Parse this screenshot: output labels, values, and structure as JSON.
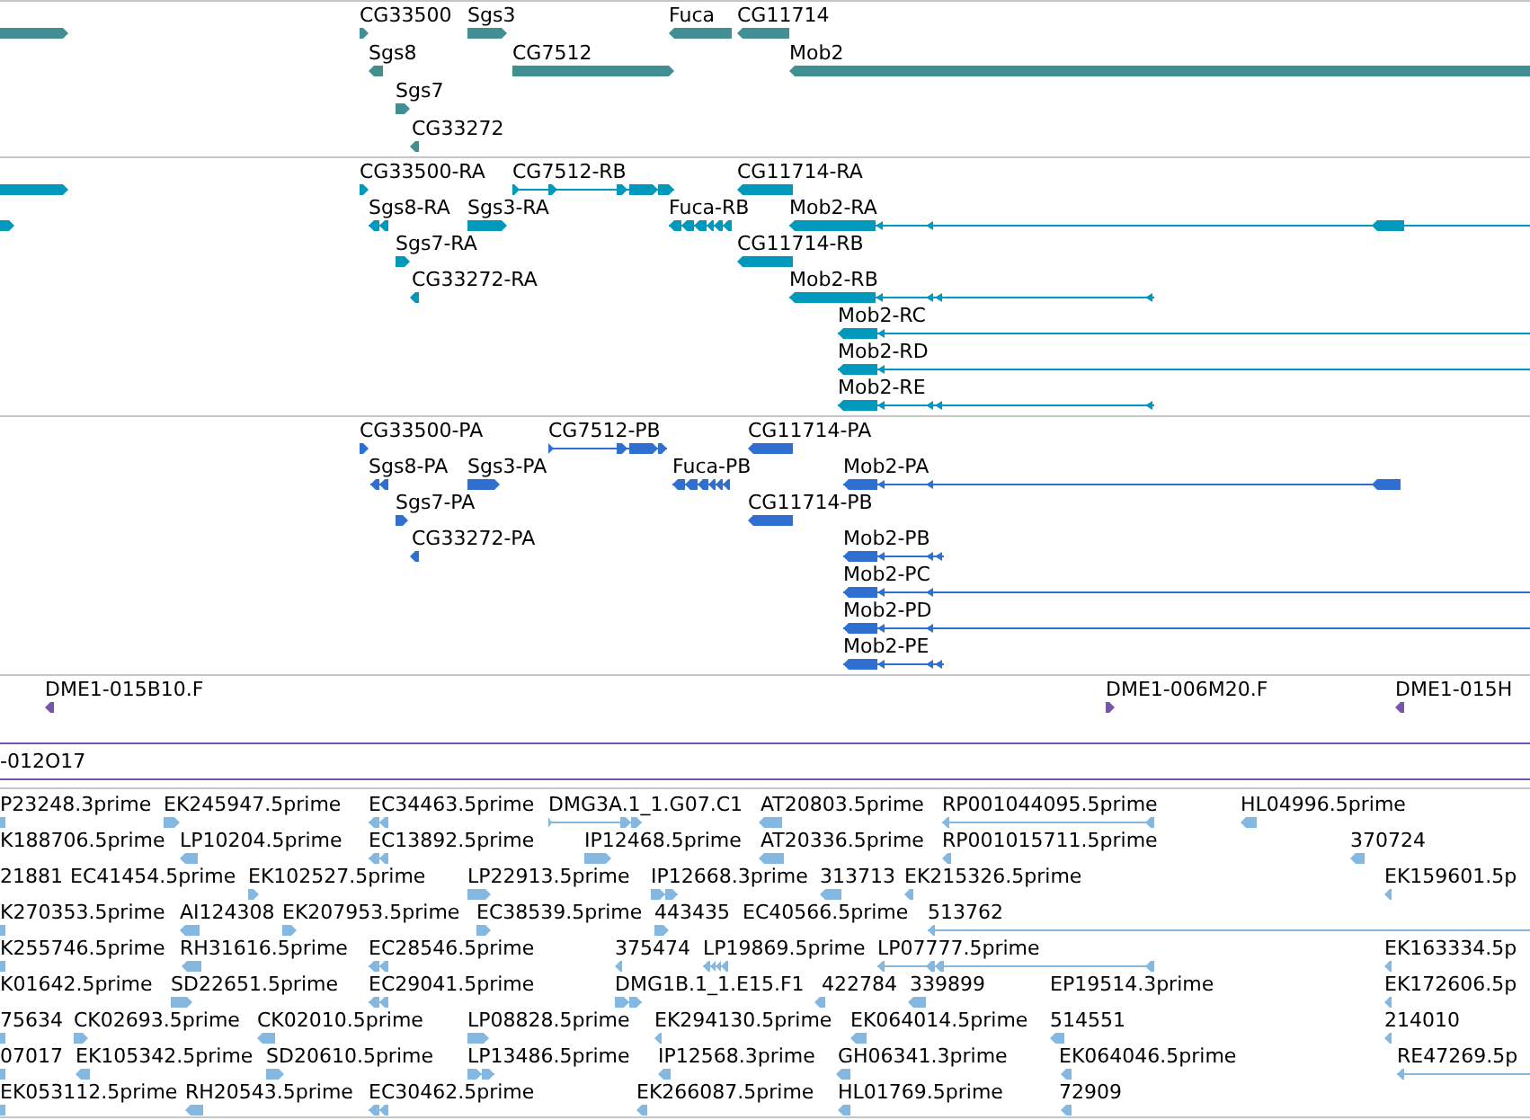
{
  "tracks": [
    {
      "color": "#418e93",
      "features": [
        {
          "kind": "block",
          "reverse": false
        },
        {
          "label": "CG33500",
          "kind": "block",
          "reverse": false
        },
        {
          "label": "Sgs3",
          "kind": "block",
          "reverse": false
        },
        {
          "label": "Fuca",
          "kind": "block",
          "reverse": true
        },
        {
          "label": "CG11714",
          "kind": "block",
          "reverse": true
        },
        {
          "label": "Sgs8",
          "kind": "block",
          "reverse": true
        },
        {
          "label": "CG7512",
          "kind": "block",
          "reverse": false
        },
        {
          "label": "Mob2",
          "kind": "block",
          "reverse": true
        },
        {
          "label": "Sgs7",
          "kind": "block",
          "reverse": false
        },
        {
          "label": "CG33272",
          "kind": "block",
          "reverse": true
        }
      ]
    },
    {
      "color": "#0099bb",
      "features": [
        {
          "kind": "block",
          "reverse": false
        },
        {
          "label": "CG33500-RA",
          "kind": "block",
          "reverse": false
        },
        {
          "label": "CG7512-RB",
          "kind": "model",
          "reverse": false
        },
        {
          "label": "CG11714-RA",
          "kind": "block",
          "reverse": true
        },
        {
          "kind": "block",
          "reverse": false
        },
        {
          "label": "Sgs8-RA",
          "kind": "model",
          "reverse": true
        },
        {
          "label": "Sgs3-RA",
          "kind": "block",
          "reverse": false
        },
        {
          "label": "Fuca-RB",
          "kind": "model",
          "reverse": true
        },
        {
          "label": "Mob2-RA",
          "kind": "model",
          "reverse": true
        },
        {
          "label": "Sgs7-RA",
          "kind": "block",
          "reverse": false
        },
        {
          "label": "CG11714-RB",
          "kind": "block",
          "reverse": true
        },
        {
          "label": "CG33272-RA",
          "kind": "block",
          "reverse": true
        },
        {
          "label": "Mob2-RB",
          "kind": "model",
          "reverse": true
        },
        {
          "label": "Mob2-RC",
          "kind": "model",
          "reverse": true
        },
        {
          "label": "Mob2-RD",
          "kind": "model",
          "reverse": true
        },
        {
          "label": "Mob2-RE",
          "kind": "model",
          "reverse": true
        }
      ]
    },
    {
      "color": "#2f6fd0",
      "features": [
        {
          "label": "CG33500-PA",
          "kind": "block",
          "reverse": false
        },
        {
          "label": "CG7512-PB",
          "kind": "model",
          "reverse": false
        },
        {
          "label": "CG11714-PA",
          "kind": "block",
          "reverse": true
        },
        {
          "label": "Sgs8-PA",
          "kind": "model",
          "reverse": true
        },
        {
          "label": "Sgs3-PA",
          "kind": "block",
          "reverse": false
        },
        {
          "label": "Fuca-PB",
          "kind": "model",
          "reverse": true
        },
        {
          "label": "Mob2-PA",
          "kind": "model",
          "reverse": true
        },
        {
          "label": "Sgs7-PA",
          "kind": "block",
          "reverse": false
        },
        {
          "label": "CG11714-PB",
          "kind": "block",
          "reverse": true
        },
        {
          "label": "CG33272-PA",
          "kind": "block",
          "reverse": true
        },
        {
          "label": "Mob2-PB",
          "kind": "model",
          "reverse": true
        },
        {
          "label": "Mob2-PC",
          "kind": "model",
          "reverse": true
        },
        {
          "label": "Mob2-PD",
          "kind": "model",
          "reverse": true
        },
        {
          "label": "Mob2-PE",
          "kind": "model",
          "reverse": true
        }
      ]
    },
    {
      "color": "#7655aa",
      "features": [
        {
          "label": "DME1-015B10.F",
          "kind": "block",
          "reverse": true
        },
        {
          "label": "DME1-006M20.F",
          "kind": "block",
          "reverse": false
        },
        {
          "label": "DME1-015H",
          "kind": "block",
          "reverse": true
        },
        {
          "kind": "line"
        },
        {
          "label": "-012O17",
          "kind": "line"
        }
      ]
    },
    {
      "color": "#84b8e0",
      "features": [
        {
          "label": "P23248.3prime",
          "kind": "block"
        },
        {
          "label": "EK245947.5prime",
          "kind": "block",
          "reverse": false
        },
        {
          "label": "EC34463.5prime",
          "kind": "model",
          "reverse": true
        },
        {
          "label": "DMG3A.1_1.G07.C1",
          "kind": "model",
          "reverse": false
        },
        {
          "label": "AT20803.5prime",
          "kind": "block",
          "reverse": true
        },
        {
          "label": "RP001044095.5prime",
          "kind": "model",
          "reverse": true
        },
        {
          "label": "HL04996.5prime",
          "kind": "block",
          "reverse": true
        },
        {
          "label": "K188706.5prime"
        },
        {
          "label": "LP10204.5prime",
          "kind": "block",
          "reverse": true
        },
        {
          "label": "EC13892.5prime",
          "kind": "model",
          "reverse": true
        },
        {
          "label": "IP12468.5prime",
          "kind": "block",
          "reverse": false
        },
        {
          "label": "AT20336.5prime",
          "kind": "block",
          "reverse": true
        },
        {
          "label": "RP001015711.5prime",
          "kind": "block",
          "reverse": true
        },
        {
          "label": "370724",
          "kind": "block",
          "reverse": true
        },
        {
          "label": "21881"
        },
        {
          "label": "EC41454.5prime"
        },
        {
          "label": "EK102527.5prime",
          "kind": "block",
          "reverse": false
        },
        {
          "label": "LP22913.5prime",
          "kind": "block",
          "reverse": false
        },
        {
          "label": "IP12668.3prime",
          "kind": "model",
          "reverse": false
        },
        {
          "label": "313713",
          "kind": "block",
          "reverse": true
        },
        {
          "label": "EK215326.5prime",
          "kind": "block",
          "reverse": true
        },
        {
          "label": "EK159601.5p",
          "kind": "block",
          "reverse": true
        },
        {
          "label": "K270353.5prime",
          "kind": "block"
        },
        {
          "label": "AI124308",
          "kind": "block",
          "reverse": true
        },
        {
          "label": "EK207953.5prime",
          "kind": "block",
          "reverse": false
        },
        {
          "label": "EC38539.5prime",
          "kind": "block",
          "reverse": false
        },
        {
          "label": "443435",
          "kind": "block",
          "reverse": false
        },
        {
          "label": "EC40566.5prime"
        },
        {
          "label": "513762",
          "kind": "model",
          "reverse": true
        },
        {
          "label": "K255746.5prime",
          "kind": "block"
        },
        {
          "label": "RH31616.5prime",
          "kind": "block",
          "reverse": true
        },
        {
          "label": "EC28546.5prime",
          "kind": "model",
          "reverse": true
        },
        {
          "label": "375474",
          "kind": "block",
          "reverse": true
        },
        {
          "label": "LP19869.5prime",
          "kind": "model",
          "reverse": true
        },
        {
          "label": "LP07777.5prime",
          "kind": "model",
          "reverse": true
        },
        {
          "label": "EK163334.5p",
          "kind": "block",
          "reverse": true
        },
        {
          "label": "K01642.5prime"
        },
        {
          "label": "SD22651.5prime",
          "kind": "block",
          "reverse": false
        },
        {
          "label": "EC29041.5prime",
          "kind": "model",
          "reverse": true
        },
        {
          "label": "DMG1B.1_1.E15.F1",
          "kind": "model",
          "reverse": false
        },
        {
          "label": "422784",
          "kind": "block",
          "reverse": true
        },
        {
          "label": "339899",
          "kind": "block",
          "reverse": true
        },
        {
          "label": "EP19514.3prime"
        },
        {
          "label": "EK172606.5p",
          "kind": "block",
          "reverse": true
        },
        {
          "label": "75634",
          "kind": "block"
        },
        {
          "label": "CK02693.5prime",
          "kind": "block",
          "reverse": false
        },
        {
          "label": "CK02010.5prime",
          "kind": "block",
          "reverse": true
        },
        {
          "label": "LP08828.5prime",
          "kind": "block",
          "reverse": false
        },
        {
          "label": "EK294130.5prime",
          "kind": "block",
          "reverse": true
        },
        {
          "label": "EK064014.5prime",
          "kind": "block",
          "reverse": true
        },
        {
          "label": "514551",
          "kind": "block",
          "reverse": true
        },
        {
          "label": "214010",
          "kind": "block",
          "reverse": true
        },
        {
          "label": "07017",
          "kind": "block"
        },
        {
          "label": "EK105342.5prime",
          "kind": "block",
          "reverse": true
        },
        {
          "label": "SD20610.5prime",
          "kind": "block",
          "reverse": false
        },
        {
          "label": "LP13486.5prime",
          "kind": "model",
          "reverse": false
        },
        {
          "label": "IP12568.3prime",
          "kind": "block",
          "reverse": true
        },
        {
          "label": "GH06341.3prime",
          "kind": "block",
          "reverse": true
        },
        {
          "label": "EK064046.5prime",
          "kind": "block",
          "reverse": true
        },
        {
          "label": "RE47269.5p",
          "kind": "model",
          "reverse": true
        },
        {
          "label": "EK053112.5prime",
          "kind": "block"
        },
        {
          "label": "RH20543.5prime",
          "kind": "block",
          "reverse": true
        },
        {
          "label": "EC30462.5prime",
          "kind": "model",
          "reverse": true
        },
        {
          "label": "EK266087.5prime",
          "kind": "block",
          "reverse": true
        },
        {
          "label": "HL01769.5prime",
          "kind": "block",
          "reverse": true
        },
        {
          "label": "72909",
          "kind": "block",
          "reverse": true
        }
      ]
    }
  ]
}
